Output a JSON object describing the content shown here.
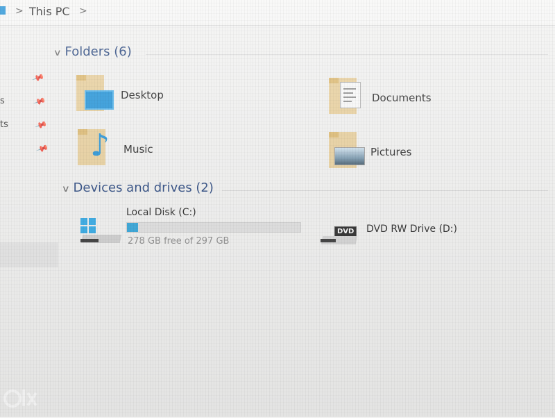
{
  "address_bar": {
    "location": "This PC",
    "separator": ">"
  },
  "nav_pane": {
    "partial_text": [
      "s",
      "ts"
    ]
  },
  "groups": {
    "folders": {
      "header": "Folders (6)",
      "items": [
        {
          "label": "Desktop",
          "icon": "desktop-folder-icon"
        },
        {
          "label": "Documents",
          "icon": "documents-folder-icon"
        },
        {
          "label": "Music",
          "icon": "music-folder-icon"
        },
        {
          "label": "Pictures",
          "icon": "pictures-folder-icon"
        }
      ]
    },
    "devices": {
      "header": "Devices and drives (2)",
      "drives": [
        {
          "label": "Local Disk (C:)",
          "free_text": "278 GB free of 297 GB",
          "used_fraction": 0.064,
          "icon": "windows-drive-icon"
        },
        {
          "label": "DVD RW Drive (D:)",
          "badge": "DVD",
          "icon": "dvd-drive-icon"
        }
      ]
    }
  },
  "watermark": "OLX",
  "colors": {
    "accent": "#1b8fd6",
    "header_blue": "#1f3f7a",
    "folder_tan": "#e9cf9a"
  }
}
